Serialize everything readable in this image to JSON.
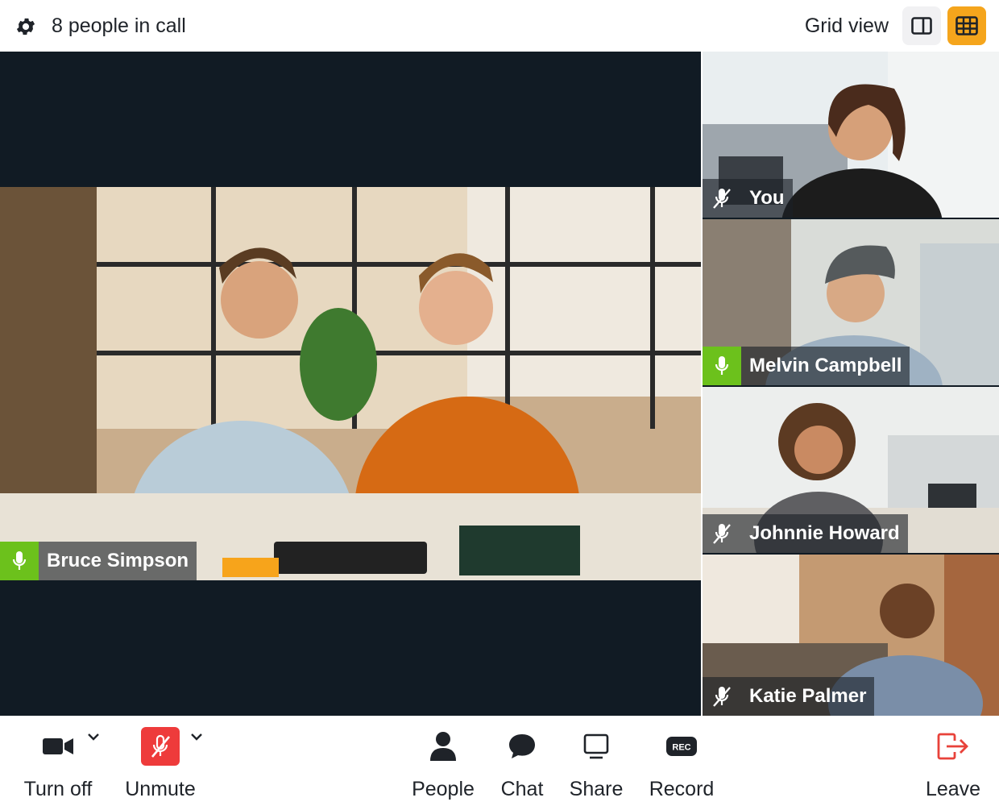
{
  "topbar": {
    "people_count": "8 people in call",
    "view_label": "Grid view",
    "accent_color": "#f5a51c"
  },
  "main_speaker": {
    "name": "Bruce Simpson",
    "mic": "on"
  },
  "participants": [
    {
      "name": "You",
      "mic": "off"
    },
    {
      "name": "Melvin Campbell",
      "mic": "on"
    },
    {
      "name": "Johnnie Howard",
      "mic": "off"
    },
    {
      "name": "Katie Palmer",
      "mic": "off"
    }
  ],
  "controls": {
    "camera": "Turn off",
    "mic": "Unmute",
    "people": "People",
    "chat": "Chat",
    "share": "Share",
    "record": "Record",
    "record_badge": "REC",
    "leave": "Leave"
  },
  "colors": {
    "mic_on": "#6cc11c",
    "mute_red": "#ee3b3b",
    "leave_red": "#e8423a",
    "stage_bg": "#111b24"
  }
}
